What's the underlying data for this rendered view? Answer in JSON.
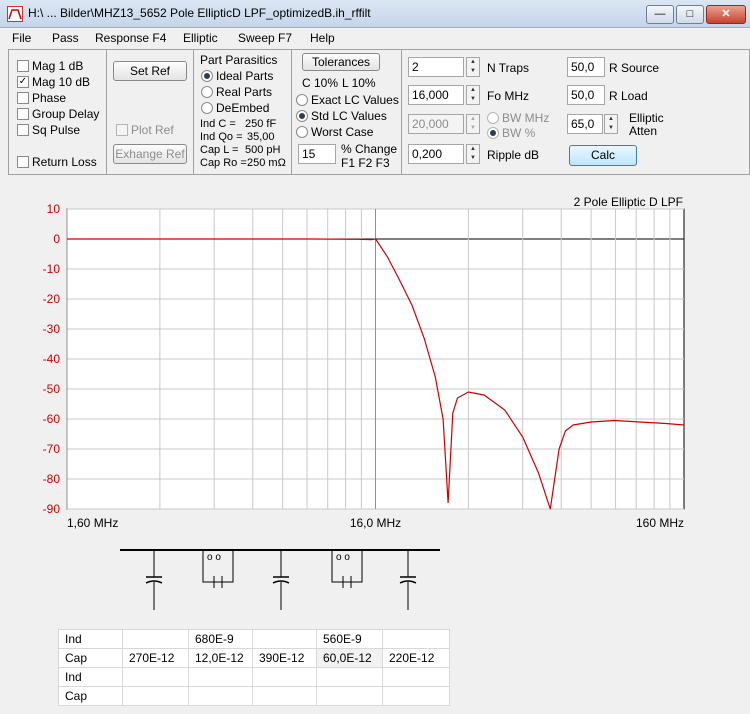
{
  "window": {
    "title": "H:\\ ... Bilder\\MHZ13_5652 Pole EllipticD LPF_optimizedB.ih_rffilt"
  },
  "menu": [
    "File",
    "Pass",
    "Response F4",
    "Elliptic",
    "Sweep F7",
    "Help"
  ],
  "response_options": [
    {
      "label": "Mag   1 dB",
      "checked": false
    },
    {
      "label": "Mag 10 dB",
      "checked": true
    },
    {
      "label": "Phase",
      "checked": false
    },
    {
      "label": "Group Delay",
      "checked": false
    },
    {
      "label": "Sq Pulse",
      "checked": false
    },
    {
      "label": "Return Loss",
      "checked": false
    }
  ],
  "ref": {
    "set_ref": "Set Ref",
    "plot_ref": "Plot Ref",
    "exchange_ref": "Exhange Ref"
  },
  "parasitics": {
    "title": "Part Parasitics",
    "options": [
      "Ideal Parts",
      "Real Parts",
      "DeEmbed"
    ],
    "selected": "Ideal Parts",
    "ind_c_label": "Ind C  =",
    "ind_c_value": "250 fF",
    "ind_qo_label": "Ind Qo =",
    "ind_qo_value": "35,00",
    "cap_l_label": "Cap L  =",
    "cap_l_value": "500 pH",
    "cap_ro_label": "Cap Ro = ",
    "cap_ro_value": "250 mΩ"
  },
  "tolerances": {
    "button": "Tolerances",
    "c_label": "C 10%",
    "l_label": "L 10%",
    "options": [
      "Exact LC Values",
      "Std LC Values",
      "Worst Case"
    ],
    "selected": "Std LC Values",
    "percent_value": "15",
    "percent_label": "% Change",
    "f_label": "F1 F2 F3"
  },
  "params": {
    "n_traps_value": "2",
    "n_traps_label": "N Traps",
    "fo_value": "16,000",
    "fo_label": "Fo  MHz",
    "bw_value": "20,000",
    "bw_mhz_label": "BW MHz",
    "bw_pct_label": "BW %",
    "ripple_value": "0,200",
    "ripple_label": "Ripple  dB",
    "r_source_value": "50,0",
    "r_source_label": "R Source",
    "r_load_value": "50,0",
    "r_load_label": "R Load",
    "atten_value": "65,0",
    "atten_label1": "Elliptic",
    "atten_label2": "Atten",
    "calc_button": "Calc"
  },
  "chart_data": {
    "type": "line",
    "title": "2 Pole Elliptic D LPF",
    "x_scale": "log",
    "xlim": [
      1.6,
      160
    ],
    "ylim": [
      -90,
      10
    ],
    "y_ticks": [
      10,
      0,
      -10,
      -20,
      -30,
      -40,
      -50,
      -60,
      -70,
      -80,
      -90
    ],
    "x_tick_labels": [
      "1,60 MHz",
      "16,0 MHz",
      "160 MHz"
    ],
    "x_tick_values": [
      1.6,
      16,
      160
    ],
    "grid": true,
    "line_color": "#cc0000",
    "series": [
      {
        "x": [
          1.6,
          5,
          10,
          14,
          15.5,
          16,
          16.5,
          17.5,
          19,
          21,
          23,
          25,
          26.5,
          27.5,
          28.5,
          29.5,
          32,
          36,
          42,
          48,
          54,
          59,
          63,
          66,
          70,
          80,
          95,
          115,
          140,
          160
        ],
        "y": [
          0,
          0,
          0,
          -0.1,
          -0.2,
          0,
          -2,
          -6,
          -13,
          -22,
          -33,
          -46,
          -60,
          -88,
          -58,
          -53,
          -51,
          -52,
          -57,
          -66,
          -78,
          -90,
          -70,
          -64,
          -62,
          -61,
          -60.5,
          -61,
          -61.5,
          -62
        ]
      }
    ]
  },
  "schematic": {
    "description_hidden": true
  },
  "lc_table": {
    "rows": [
      [
        "Ind",
        "",
        "680E-9",
        "",
        "560E-9",
        ""
      ],
      [
        "Cap",
        "270E-12",
        "12,0E-12",
        "390E-12",
        "60,0E-12",
        "220E-12"
      ],
      [
        "Ind",
        "",
        "",
        "",
        "",
        ""
      ],
      [
        "Cap",
        "",
        "",
        "",
        "",
        ""
      ]
    ]
  }
}
